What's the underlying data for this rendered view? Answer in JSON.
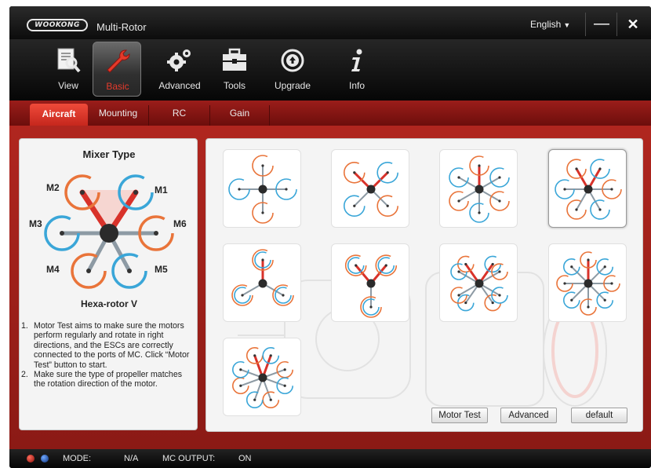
{
  "window": {
    "app_title": "Multi-Rotor",
    "logo_text": "WOOKONG",
    "language": "English",
    "minimize_glyph": "—",
    "close_glyph": "✕"
  },
  "toolbar": {
    "items": [
      {
        "label": "View",
        "icon": "view-icon"
      },
      {
        "label": "Basic",
        "icon": "wrench-icon",
        "active": true
      },
      {
        "label": "Advanced",
        "icon": "gears-icon"
      },
      {
        "label": "Tools",
        "icon": "toolbox-icon"
      },
      {
        "label": "Upgrade",
        "icon": "upgrade-icon"
      },
      {
        "label": "Info",
        "icon": "info-icon"
      }
    ]
  },
  "tabs": [
    {
      "label": "Aircraft",
      "active": true
    },
    {
      "label": "Mounting"
    },
    {
      "label": "RC"
    },
    {
      "label": "Gain"
    }
  ],
  "mixer": {
    "title": "Mixer Type",
    "name": "Hexa-rotor V",
    "motors": [
      "M1",
      "M2",
      "M3",
      "M4",
      "M5",
      "M6"
    ],
    "notes": [
      {
        "num": "1.",
        "text": "Motor Test aims to make sure the motors perform regularly and rotate in right directions, and the ESCs are correctly connected to the ports of MC. Click “Motor Test” button to start."
      },
      {
        "num": "2.",
        "text": "Make sure the type of propeller matches the rotation direction of the motor."
      }
    ]
  },
  "mixer_options": [
    {
      "type": "quad-plus"
    },
    {
      "type": "quad-x"
    },
    {
      "type": "hexa-i"
    },
    {
      "type": "hexa-v",
      "selected": true
    },
    {
      "type": "hexa-y"
    },
    {
      "type": "hexa-iy"
    },
    {
      "type": "octo-x"
    },
    {
      "type": "octo-i"
    },
    {
      "type": "octo-v"
    }
  ],
  "buttons": {
    "motor_test": "Motor Test",
    "advanced": "Advanced",
    "default": "default"
  },
  "status": {
    "mode_label": "MODE:",
    "mode_value": "N/A",
    "output_label": "MC OUTPUT:",
    "output_value": "ON"
  },
  "colors": {
    "accent_red": "#d8322a",
    "cw_orange": "#e9743a",
    "ccw_blue": "#3aa6d8"
  }
}
